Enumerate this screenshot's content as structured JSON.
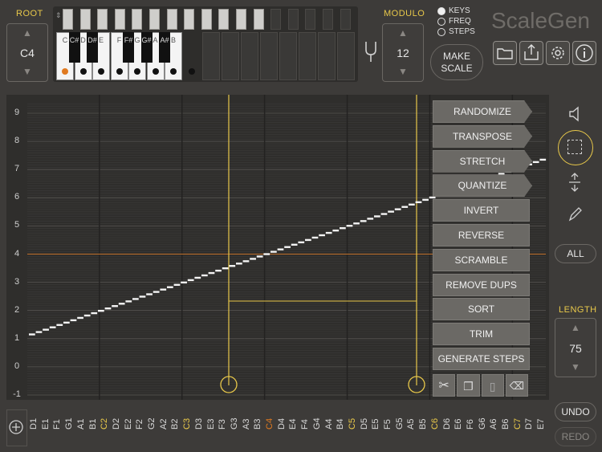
{
  "header": {
    "root_label": "ROOT",
    "root_value": "C4",
    "modulo_label": "MODULO",
    "modulo_value": "12",
    "make_scale": "MAKE\nSCALE",
    "app_title": "ScaleGen",
    "mode_options": [
      {
        "label": "KEYS",
        "selected": true
      },
      {
        "label": "FREQ",
        "selected": false
      },
      {
        "label": "STEPS",
        "selected": false
      }
    ],
    "keys": [
      "C",
      "C#",
      "D",
      "D#",
      "E",
      "F",
      "F#",
      "G",
      "G#",
      "A",
      "A#",
      "B"
    ],
    "active_key_color": "#e07a20"
  },
  "graph": {
    "y_ticks": [
      "9",
      "8",
      "7",
      "6",
      "5",
      "4",
      "3",
      "2",
      "1",
      "0",
      "-1"
    ],
    "x_labels": [
      "D1",
      "E1",
      "F1",
      "G1",
      "A1",
      "B1",
      "C2",
      "D2",
      "E2",
      "F2",
      "G2",
      "A2",
      "B2",
      "C3",
      "D3",
      "E3",
      "F3",
      "G3",
      "A3",
      "B3",
      "C4",
      "D4",
      "E4",
      "F4",
      "G4",
      "A4",
      "B4",
      "C5",
      "D5",
      "E5",
      "F5",
      "G5",
      "A5",
      "B5",
      "C6",
      "D6",
      "E6",
      "F6",
      "G6",
      "A6",
      "B6",
      "C7",
      "D7",
      "E7"
    ],
    "x_label_colors": {
      "C2": "#e8c84a",
      "C3": "#e8c84a",
      "C4": "#e07a20",
      "C5": "#e8c84a",
      "C6": "#e8c84a",
      "C7": "#e8c84a"
    },
    "selection_color": "#e8c84a",
    "reference_line_color": "#c0702a"
  },
  "menu": {
    "items": [
      "RANDOMIZE",
      "TRANSPOSE",
      "STRETCH",
      "QUANTIZE",
      "INVERT",
      "REVERSE",
      "SCRAMBLE",
      "REMOVE DUPS",
      "SORT",
      "TRIM",
      "GENERATE STEPS"
    ]
  },
  "sidebar": {
    "all_label": "ALL",
    "length_label": "LENGTH",
    "length_value": "75",
    "undo_label": "UNDO",
    "redo_label": "REDO"
  }
}
